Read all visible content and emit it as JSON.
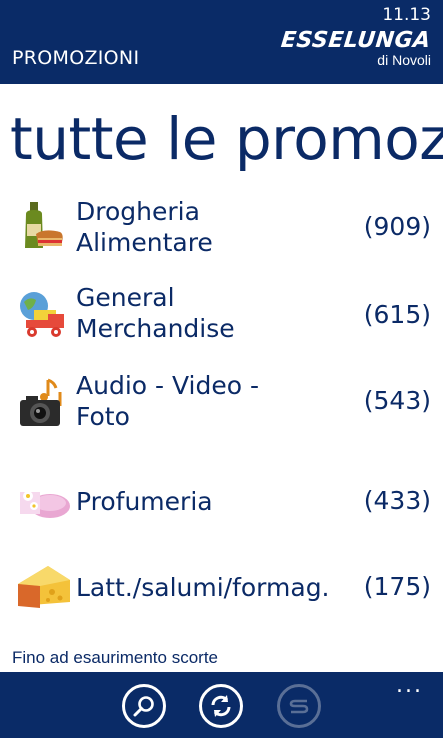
{
  "status_bar": {
    "time": "11.13"
  },
  "header": {
    "title": "PROMOZIONI",
    "brand_name": "ESSELUNGA",
    "brand_store": "di Novoli"
  },
  "page": {
    "heading": "tutte le promoz"
  },
  "categories": [
    {
      "label": "Drogheria Alimentare",
      "count": "(909)",
      "icon": "grocery-bottle-bread-icon"
    },
    {
      "label": "General Merchandise",
      "count": "(615)",
      "icon": "toy-truck-globe-icon"
    },
    {
      "label": "Audio - Video - Foto",
      "count": "(543)",
      "icon": "camera-music-note-icon"
    },
    {
      "label": "Profumeria",
      "count": "(433)",
      "icon": "soap-flower-icon"
    },
    {
      "label": "Latt./salumi/formag.",
      "count": "(175)",
      "icon": "cheese-wedge-icon"
    }
  ],
  "footer": {
    "note": "Fino ad esaurimento scorte"
  },
  "app_bar": {
    "buttons": [
      "search-icon",
      "refresh-icon",
      "s-logo-icon"
    ],
    "more": "..."
  },
  "colors": {
    "header_bg": "#0a2b67",
    "text": "#0b2a66",
    "background": "#ffffff"
  }
}
